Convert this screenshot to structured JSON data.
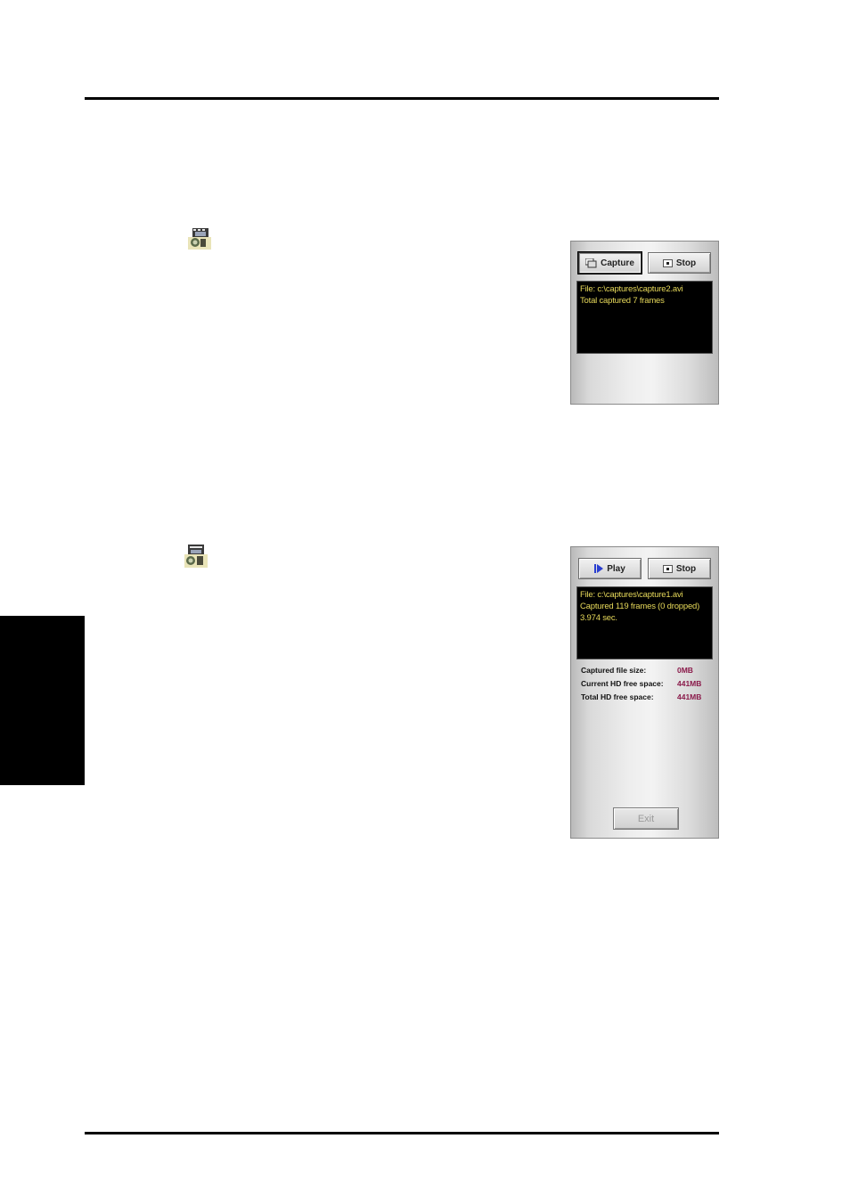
{
  "capture_window": {
    "capture_button": "Capture",
    "stop_button": "Stop",
    "console_lines": [
      "File: c:\\captures\\capture2.avi",
      "Total captured 7 frames"
    ]
  },
  "play_window": {
    "play_button": "Play",
    "stop_button": "Stop",
    "console_lines": [
      "File: c:\\captures\\capture1.avi",
      "Captured 119 frames (0 dropped) 3.974 sec."
    ],
    "stats": [
      {
        "label": "Captured file size:",
        "value": "0MB"
      },
      {
        "label": "Current HD free space:",
        "value": "441MB"
      },
      {
        "label": "Total HD free space:",
        "value": "441MB"
      }
    ],
    "exit_button": "Exit"
  },
  "icons": {
    "capture_app": "film-camera-icon",
    "playback_app": "film-camera-icon"
  },
  "colors": {
    "console_background": "#000000",
    "console_text": "#e7d95a",
    "stat_value": "#8a1a4a",
    "play_arrow": "#2a3fd0"
  }
}
